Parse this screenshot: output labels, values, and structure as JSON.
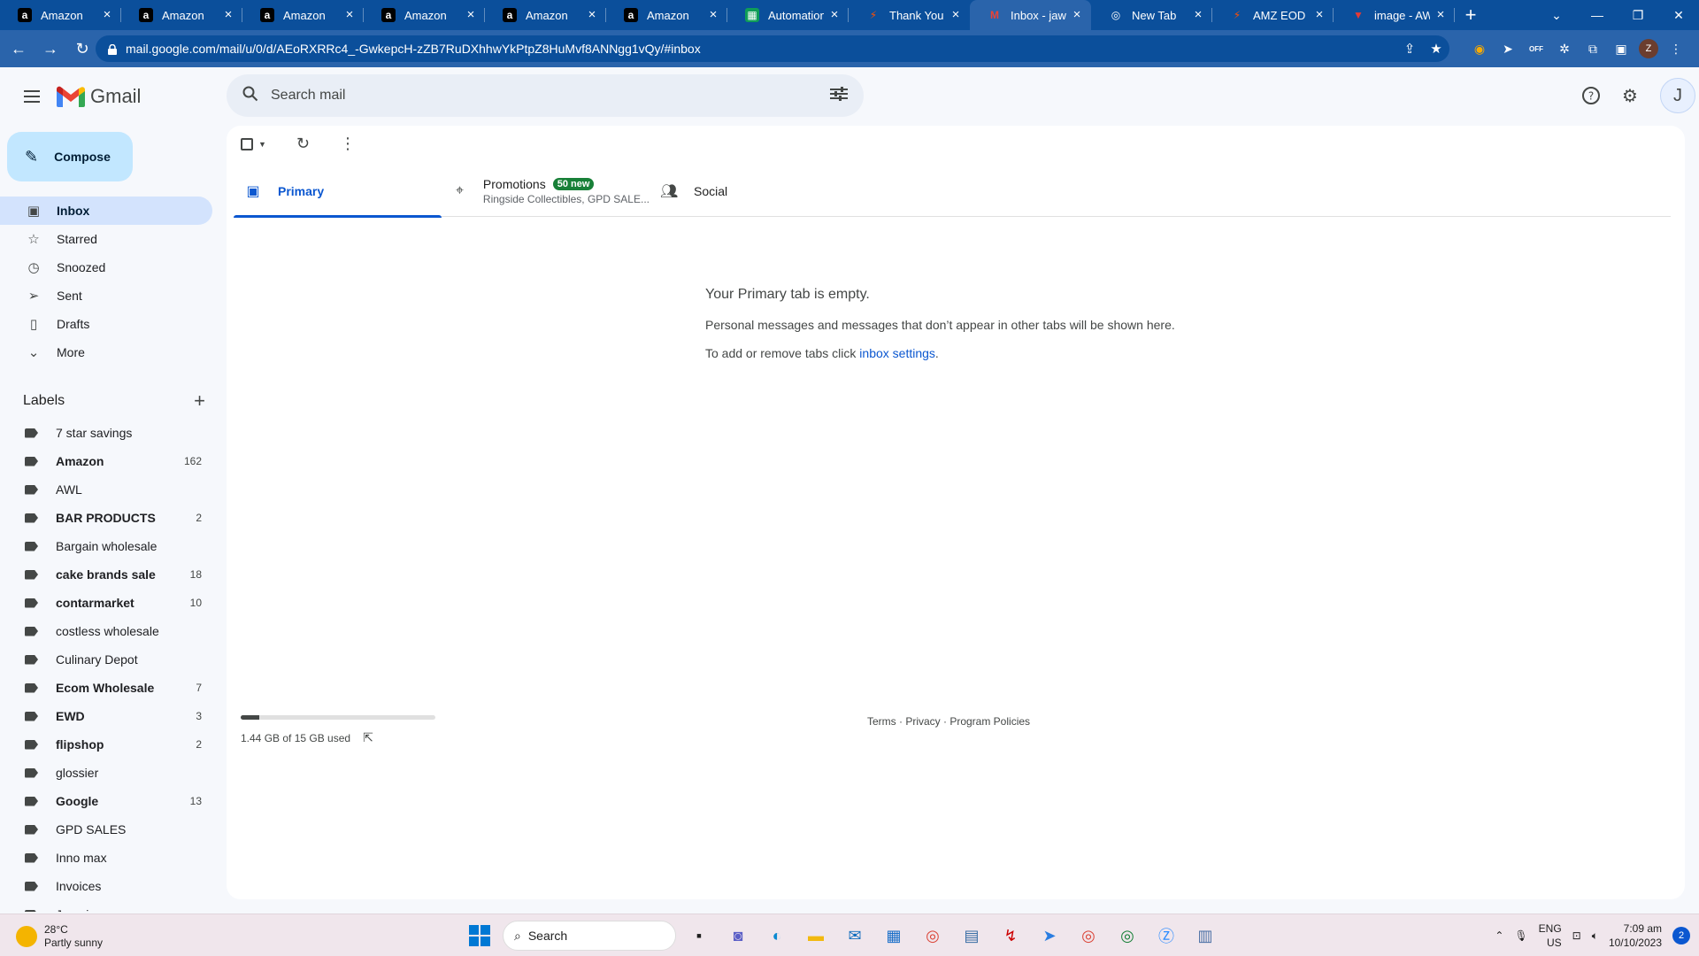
{
  "browser": {
    "tabs": [
      {
        "title": "Amazon",
        "icon": "amazon-icon"
      },
      {
        "title": "Amazon",
        "icon": "amazon-icon"
      },
      {
        "title": "Amazon",
        "icon": "amazon-icon"
      },
      {
        "title": "Amazon",
        "icon": "amazon-icon"
      },
      {
        "title": "Amazon",
        "icon": "amazon-icon"
      },
      {
        "title": "Amazon",
        "icon": "amazon-icon"
      },
      {
        "title": "Automation",
        "icon": "sheets-icon"
      },
      {
        "title": "Thank You",
        "icon": "zapier-icon"
      },
      {
        "title": "Inbox - jawc",
        "icon": "gmail-icon"
      },
      {
        "title": "New Tab",
        "icon": "chrome-icon"
      },
      {
        "title": "AMZ EOD Re",
        "icon": "zapier-icon"
      },
      {
        "title": "image - AWL",
        "icon": "image-icon"
      }
    ],
    "url": "mail.google.com/mail/u/0/d/AEoRXRRc4_-GwkepcH-zZB7RuDXhhwYkPtpZ8HuMvf8ANNgg1vQy/#inbox",
    "extensions": {
      "off_badge": "OFF",
      "profile_initial": "Z"
    }
  },
  "gmail": {
    "app_name": "Gmail",
    "search_placeholder": "Search mail",
    "avatar_initial": "J",
    "compose_label": "Compose",
    "nav": [
      {
        "label": "Inbox",
        "icon": "inbox-icon"
      },
      {
        "label": "Starred",
        "icon": "star-icon"
      },
      {
        "label": "Snoozed",
        "icon": "clock-icon"
      },
      {
        "label": "Sent",
        "icon": "send-icon"
      },
      {
        "label": "Drafts",
        "icon": "draft-icon"
      },
      {
        "label": "More",
        "icon": "chevron-down-icon"
      }
    ],
    "labels_title": "Labels",
    "labels": [
      {
        "name": "7 star savings",
        "count": "",
        "bold": false
      },
      {
        "name": "Amazon",
        "count": "162",
        "bold": true
      },
      {
        "name": "AWL",
        "count": "",
        "bold": false
      },
      {
        "name": "BAR PRODUCTS",
        "count": "2",
        "bold": true
      },
      {
        "name": "Bargain wholesale",
        "count": "",
        "bold": false
      },
      {
        "name": "cake brands sale",
        "count": "18",
        "bold": true
      },
      {
        "name": "contarmarket",
        "count": "10",
        "bold": true
      },
      {
        "name": "costless wholesale",
        "count": "",
        "bold": false
      },
      {
        "name": "Culinary Depot",
        "count": "",
        "bold": false
      },
      {
        "name": "Ecom Wholesale",
        "count": "7",
        "bold": true
      },
      {
        "name": "EWD",
        "count": "3",
        "bold": true
      },
      {
        "name": "flipshop",
        "count": "2",
        "bold": true
      },
      {
        "name": "glossier",
        "count": "",
        "bold": false
      },
      {
        "name": "Google",
        "count": "13",
        "bold": true
      },
      {
        "name": "GPD SALES",
        "count": "",
        "bold": false
      },
      {
        "name": "Inno max",
        "count": "",
        "bold": false
      },
      {
        "name": "Invoices",
        "count": "",
        "bold": false
      },
      {
        "name": "Jerasim",
        "count": "",
        "bold": false
      }
    ],
    "inbox_tabs": {
      "primary": "Primary",
      "promotions": "Promotions",
      "promotions_badge": "50 new",
      "promotions_sub": "Ringside Collectibles, GPD SALE...",
      "social": "Social"
    },
    "empty_state": {
      "title": "Your Primary tab is empty.",
      "line1": "Personal messages and messages that don’t appear in other tabs will be shown here.",
      "line2_prefix": "To add or remove tabs click ",
      "line2_link": "inbox settings",
      "line2_suffix": "."
    },
    "storage": {
      "text": "1.44 GB of 15 GB used",
      "used_fraction": 0.096
    },
    "footer": "Terms · Privacy · Program Policies"
  },
  "taskbar": {
    "weather_temp": "28°C",
    "weather_desc": "Partly sunny",
    "search_label": "Search",
    "lang_top": "ENG",
    "lang_bottom": "US",
    "time": "7:09 am",
    "date": "10/10/2023",
    "notif_count": "2"
  },
  "colors": {
    "accent": "#0b57d0",
    "chrome": "#2a64ab",
    "compose": "#c2e7ff"
  }
}
